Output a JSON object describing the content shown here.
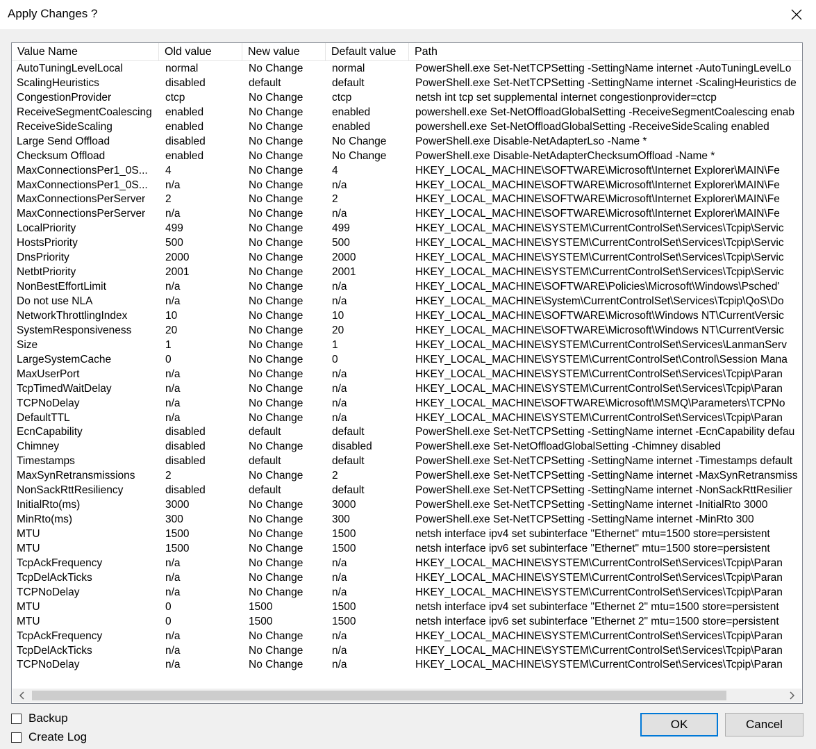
{
  "window": {
    "title": "Apply Changes ?"
  },
  "columns": [
    "Value Name",
    "Old value",
    "New value",
    "Default value",
    "Path"
  ],
  "rows": [
    [
      "AutoTuningLevelLocal",
      "normal",
      "No Change",
      "normal",
      "PowerShell.exe Set-NetTCPSetting -SettingName internet -AutoTuningLevelLo"
    ],
    [
      "ScalingHeuristics",
      "disabled",
      "default",
      "default",
      "PowerShell.exe Set-NetTCPSetting -SettingName internet -ScalingHeuristics de"
    ],
    [
      "CongestionProvider",
      "ctcp",
      "No Change",
      "ctcp",
      "netsh int tcp set supplemental internet congestionprovider=ctcp"
    ],
    [
      "ReceiveSegmentCoalescing",
      "enabled",
      "No Change",
      "enabled",
      "powershell.exe Set-NetOffloadGlobalSetting -ReceiveSegmentCoalescing enab"
    ],
    [
      "ReceiveSideScaling",
      "enabled",
      "No Change",
      "enabled",
      "powershell.exe Set-NetOffloadGlobalSetting -ReceiveSideScaling enabled"
    ],
    [
      "Large Send Offload",
      "disabled",
      "No Change",
      "No Change",
      "PowerShell.exe Disable-NetAdapterLso -Name *"
    ],
    [
      "Checksum Offload",
      "enabled",
      "No Change",
      "No Change",
      "PowerShell.exe Disable-NetAdapterChecksumOffload -Name *"
    ],
    [
      "MaxConnectionsPer1_0S...",
      "4",
      "No Change",
      "4",
      "HKEY_LOCAL_MACHINE\\SOFTWARE\\Microsoft\\Internet Explorer\\MAIN\\Fe"
    ],
    [
      "MaxConnectionsPer1_0S...",
      "n/a",
      "No Change",
      "n/a",
      "HKEY_LOCAL_MACHINE\\SOFTWARE\\Microsoft\\Internet Explorer\\MAIN\\Fe"
    ],
    [
      "MaxConnectionsPerServer",
      "2",
      "No Change",
      "2",
      "HKEY_LOCAL_MACHINE\\SOFTWARE\\Microsoft\\Internet Explorer\\MAIN\\Fe"
    ],
    [
      "MaxConnectionsPerServer",
      "n/a",
      "No Change",
      "n/a",
      "HKEY_LOCAL_MACHINE\\SOFTWARE\\Microsoft\\Internet Explorer\\MAIN\\Fe"
    ],
    [
      "LocalPriority",
      "499",
      "No Change",
      "499",
      "HKEY_LOCAL_MACHINE\\SYSTEM\\CurrentControlSet\\Services\\Tcpip\\Servic"
    ],
    [
      "HostsPriority",
      "500",
      "No Change",
      "500",
      "HKEY_LOCAL_MACHINE\\SYSTEM\\CurrentControlSet\\Services\\Tcpip\\Servic"
    ],
    [
      "DnsPriority",
      "2000",
      "No Change",
      "2000",
      "HKEY_LOCAL_MACHINE\\SYSTEM\\CurrentControlSet\\Services\\Tcpip\\Servic"
    ],
    [
      "NetbtPriority",
      "2001",
      "No Change",
      "2001",
      "HKEY_LOCAL_MACHINE\\SYSTEM\\CurrentControlSet\\Services\\Tcpip\\Servic"
    ],
    [
      "NonBestEffortLimit",
      "n/a",
      "No Change",
      "n/a",
      "HKEY_LOCAL_MACHINE\\SOFTWARE\\Policies\\Microsoft\\Windows\\Psched'"
    ],
    [
      "Do not use NLA",
      "n/a",
      "No Change",
      "n/a",
      "HKEY_LOCAL_MACHINE\\System\\CurrentControlSet\\Services\\Tcpip\\QoS\\Do"
    ],
    [
      "NetworkThrottlingIndex",
      "10",
      "No Change",
      "10",
      "HKEY_LOCAL_MACHINE\\SOFTWARE\\Microsoft\\Windows NT\\CurrentVersic"
    ],
    [
      "SystemResponsiveness",
      "20",
      "No Change",
      "20",
      "HKEY_LOCAL_MACHINE\\SOFTWARE\\Microsoft\\Windows NT\\CurrentVersic"
    ],
    [
      "Size",
      "1",
      "No Change",
      "1",
      "HKEY_LOCAL_MACHINE\\SYSTEM\\CurrentControlSet\\Services\\LanmanServ"
    ],
    [
      "LargeSystemCache",
      "0",
      "No Change",
      "0",
      "HKEY_LOCAL_MACHINE\\SYSTEM\\CurrentControlSet\\Control\\Session Mana"
    ],
    [
      "MaxUserPort",
      "n/a",
      "No Change",
      "n/a",
      "HKEY_LOCAL_MACHINE\\SYSTEM\\CurrentControlSet\\Services\\Tcpip\\Paran"
    ],
    [
      "TcpTimedWaitDelay",
      "n/a",
      "No Change",
      "n/a",
      "HKEY_LOCAL_MACHINE\\SYSTEM\\CurrentControlSet\\Services\\Tcpip\\Paran"
    ],
    [
      "TCPNoDelay",
      "n/a",
      "No Change",
      "n/a",
      "HKEY_LOCAL_MACHINE\\SOFTWARE\\Microsoft\\MSMQ\\Parameters\\TCPNo"
    ],
    [
      "DefaultTTL",
      "n/a",
      "No Change",
      "n/a",
      "HKEY_LOCAL_MACHINE\\SYSTEM\\CurrentControlSet\\Services\\Tcpip\\Paran"
    ],
    [
      "EcnCapability",
      "disabled",
      "default",
      "default",
      "PowerShell.exe Set-NetTCPSetting -SettingName internet -EcnCapability defau"
    ],
    [
      "Chimney",
      "disabled",
      "No Change",
      "disabled",
      "PowerShell.exe Set-NetOffloadGlobalSetting -Chimney disabled"
    ],
    [
      "Timestamps",
      "disabled",
      "default",
      "default",
      "PowerShell.exe Set-NetTCPSetting -SettingName internet -Timestamps default"
    ],
    [
      "MaxSynRetransmissions",
      "2",
      "No Change",
      "2",
      "PowerShell.exe Set-NetTCPSetting -SettingName internet -MaxSynRetransmiss"
    ],
    [
      "NonSackRttResiliency",
      "disabled",
      "default",
      "default",
      "PowerShell.exe Set-NetTCPSetting -SettingName internet -NonSackRttResilier"
    ],
    [
      "InitialRto(ms)",
      "3000",
      "No Change",
      "3000",
      "PowerShell.exe Set-NetTCPSetting -SettingName internet -InitialRto 3000"
    ],
    [
      "MinRto(ms)",
      "300",
      "No Change",
      "300",
      "PowerShell.exe Set-NetTCPSetting -SettingName internet -MinRto 300"
    ],
    [
      "MTU",
      "1500",
      "No Change",
      "1500",
      "netsh interface ipv4 set subinterface \"Ethernet\" mtu=1500 store=persistent"
    ],
    [
      "MTU",
      "1500",
      "No Change",
      "1500",
      "netsh interface ipv6 set subinterface \"Ethernet\" mtu=1500 store=persistent"
    ],
    [
      "TcpAckFrequency",
      "n/a",
      "No Change",
      "n/a",
      "HKEY_LOCAL_MACHINE\\SYSTEM\\CurrentControlSet\\Services\\Tcpip\\Paran"
    ],
    [
      "TcpDelAckTicks",
      "n/a",
      "No Change",
      "n/a",
      "HKEY_LOCAL_MACHINE\\SYSTEM\\CurrentControlSet\\Services\\Tcpip\\Paran"
    ],
    [
      "TCPNoDelay",
      "n/a",
      "No Change",
      "n/a",
      "HKEY_LOCAL_MACHINE\\SYSTEM\\CurrentControlSet\\Services\\Tcpip\\Paran"
    ],
    [
      "MTU",
      "0",
      "1500",
      "1500",
      "netsh interface ipv4 set subinterface \"Ethernet 2\" mtu=1500 store=persistent"
    ],
    [
      "MTU",
      "0",
      "1500",
      "1500",
      "netsh interface ipv6 set subinterface \"Ethernet 2\" mtu=1500 store=persistent"
    ],
    [
      "TcpAckFrequency",
      "n/a",
      "No Change",
      "n/a",
      "HKEY_LOCAL_MACHINE\\SYSTEM\\CurrentControlSet\\Services\\Tcpip\\Paran"
    ],
    [
      "TcpDelAckTicks",
      "n/a",
      "No Change",
      "n/a",
      "HKEY_LOCAL_MACHINE\\SYSTEM\\CurrentControlSet\\Services\\Tcpip\\Paran"
    ],
    [
      "TCPNoDelay",
      "n/a",
      "No Change",
      "n/a",
      "HKEY_LOCAL_MACHINE\\SYSTEM\\CurrentControlSet\\Services\\Tcpip\\Paran"
    ]
  ],
  "options": {
    "backup_label": "Backup",
    "log_label": "Create Log"
  },
  "buttons": {
    "ok": "OK",
    "cancel": "Cancel"
  },
  "icons": {
    "close": "close-icon",
    "scroll_left": "chevron-left-icon",
    "scroll_right": "chevron-right-icon"
  }
}
